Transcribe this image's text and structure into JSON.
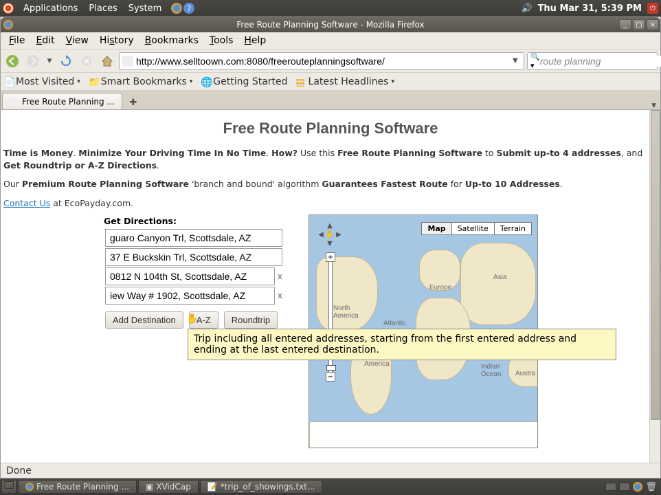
{
  "gnome": {
    "menus": [
      "Applications",
      "Places",
      "System"
    ],
    "clock": "Thu Mar 31,  5:39 PM"
  },
  "window": {
    "title": "Free Route Planning Software - Mozilla Firefox"
  },
  "menubar": [
    "File",
    "Edit",
    "View",
    "History",
    "Bookmarks",
    "Tools",
    "Help"
  ],
  "url": "http://www.selltoown.com:8080/freerouteplanningsoftware/",
  "search_value": "route planning",
  "bookmarks": [
    "Most Visited",
    "Smart Bookmarks",
    "Getting Started",
    "Latest Headlines"
  ],
  "tab_label": "Free Route Planning ...",
  "page": {
    "heading": "Free Route Planning Software",
    "p1_a": "Time is Money",
    "p1_b": ". ",
    "p1_c": "Minimize Your Driving Time In No Time",
    "p1_d": ". ",
    "p1_e": "How?",
    "p1_f": " Use this ",
    "p1_g": "Free Route Planning Software",
    "p1_h": " to ",
    "p1_i": "Submit up-to 4 addresses",
    "p1_j": ", and ",
    "p1_k": "Get Roundtrip or A-Z Directions",
    "p1_l": ".",
    "p2_a": "Our ",
    "p2_b": "Premium Route Planning Software",
    "p2_c": " 'branch and bound' algorithm ",
    "p2_d": "Guarantees Fastest Route",
    "p2_e": " for ",
    "p2_f": "Up-to 10 Addresses",
    "p2_g": ".",
    "contact": "Contact Us",
    "contact_tail": " at EcoPayday.com.",
    "dir_label": "Get Directions:",
    "addresses": [
      "guaro Canyon Trl, Scottsdale, AZ",
      "37 E Buckskin Trl, Scottsdale, AZ",
      "0812 N 104th St, Scottsdale, AZ",
      "iew Way # 1902, Scottsdale, AZ"
    ],
    "add_btn": "Add Destination",
    "az_btn": "A-Z",
    "round_btn": "Roundtrip",
    "tooltip": "Trip including all entered addresses, starting from the first entered address and ending at the last entered destination."
  },
  "map": {
    "tabs": [
      "Map",
      "Satellite",
      "Terrain"
    ],
    "labels": {
      "na": "North\nAmerica",
      "sa": "South\nAmerica",
      "eu": "Europe",
      "asia": "Asia",
      "atlantic": "Atlantic",
      "indian": "Indian\nOcean",
      "aus": "Austra"
    }
  },
  "status": "Done",
  "taskbar": {
    "items": [
      "Free Route Planning ...",
      "XVidCap",
      "*trip_of_showings.txt..."
    ]
  }
}
